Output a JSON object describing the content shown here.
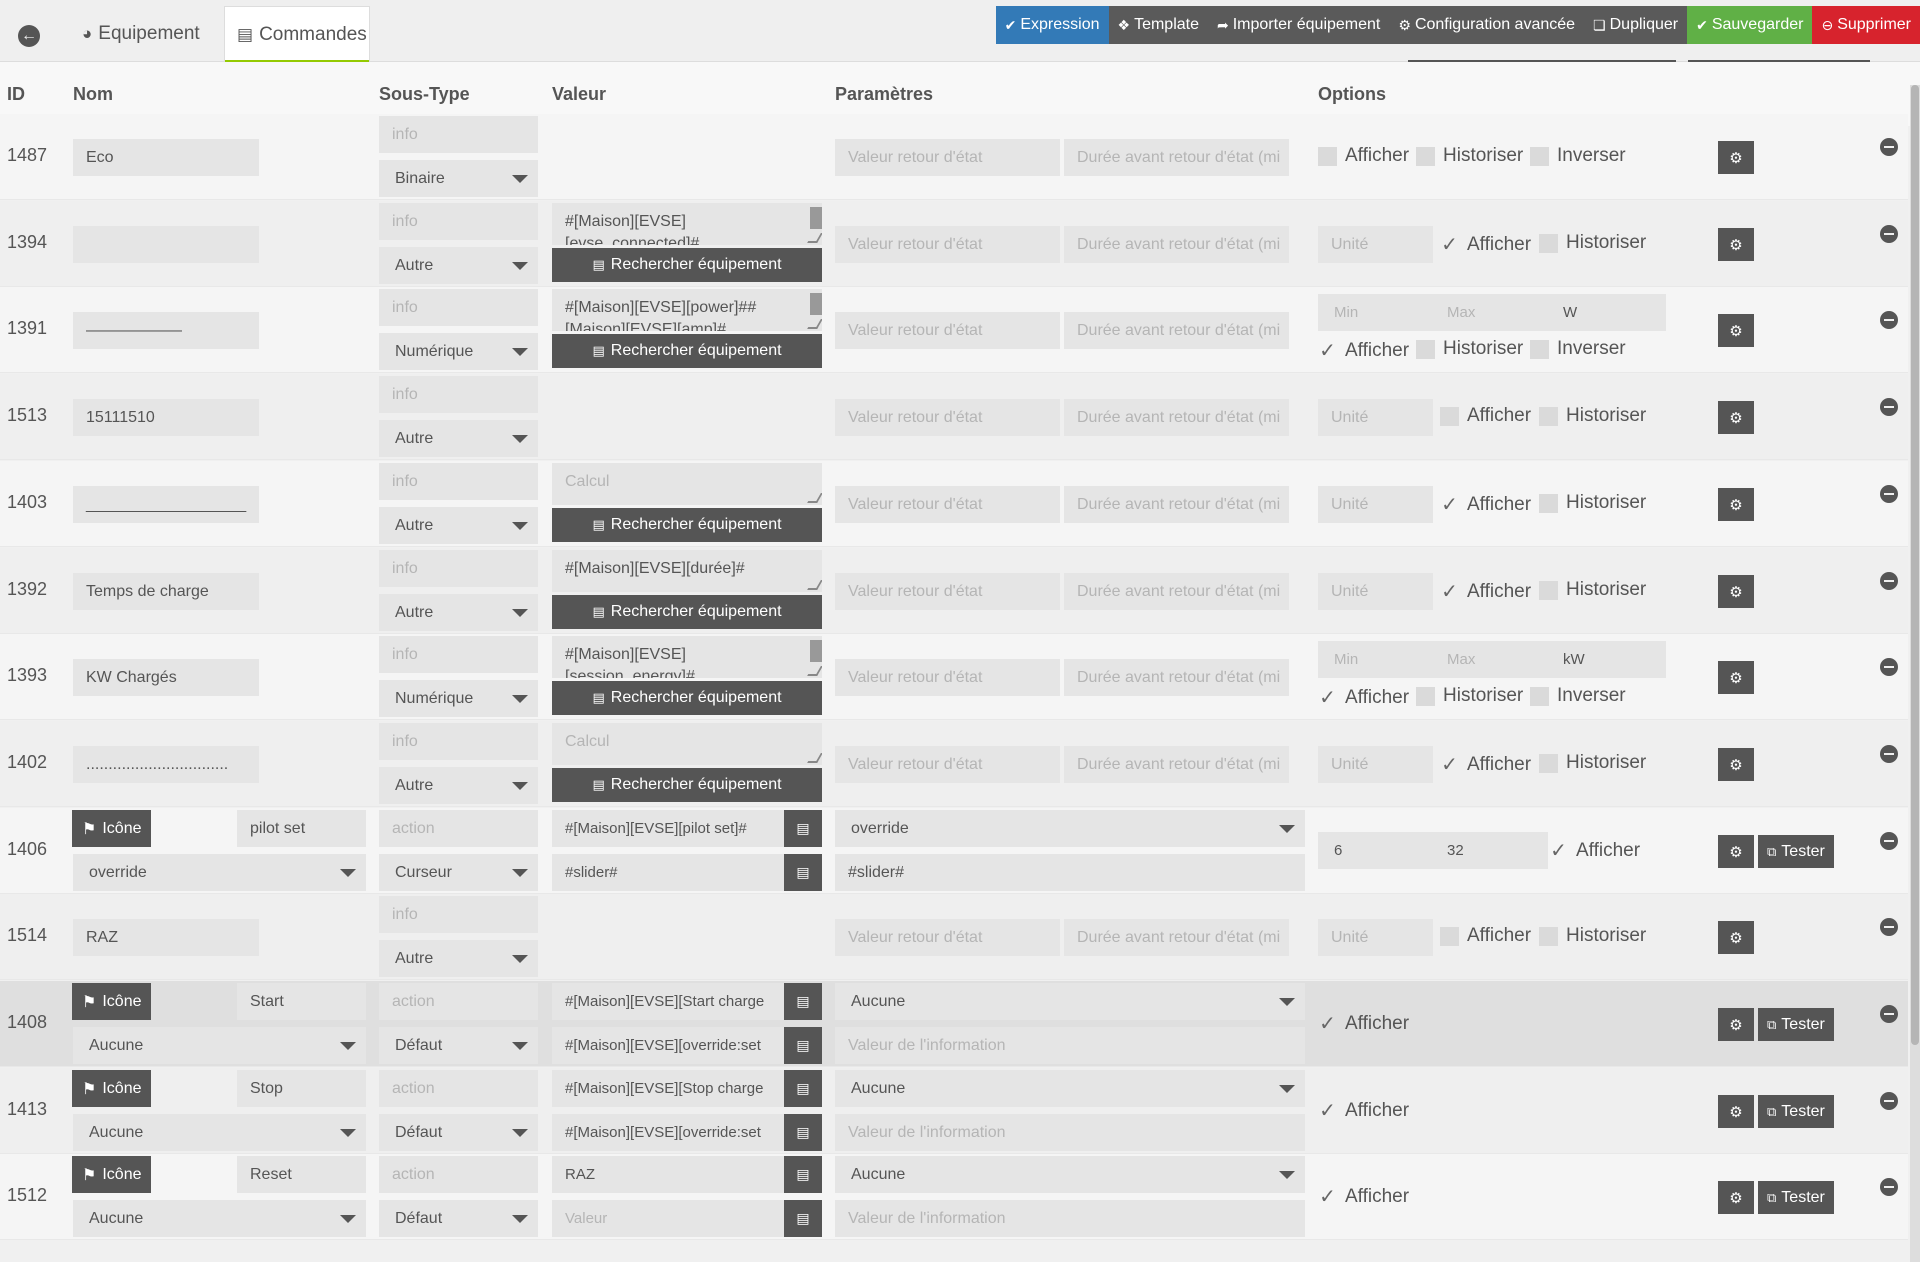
{
  "topbar": {
    "tabs": [
      {
        "icon": "tachometer-icon",
        "label": "Equipement"
      },
      {
        "icon": "list-icon",
        "label": "Commandes"
      }
    ],
    "actions": [
      {
        "label": "Expression",
        "icon": "check-icon"
      },
      {
        "label": "Template",
        "icon": "cubes-icon"
      },
      {
        "label": "Importer équipement",
        "icon": "share-icon"
      },
      {
        "label": "Configuration avancée",
        "icon": "cogs-icon"
      },
      {
        "label": "Dupliquer",
        "icon": "copy-icon"
      },
      {
        "label": "Sauvegarder",
        "icon": "check-circle-icon"
      },
      {
        "label": "Supprimer",
        "icon": "minus-circle-icon"
      }
    ],
    "colors": {
      "expression": "#337ab7",
      "save": "#60b046",
      "delete": "#d7232d",
      "active_tab": "#94ca02"
    }
  },
  "table": {
    "headers": {
      "id": "ID",
      "name": "Nom",
      "subtype": "Sous-Type",
      "value": "Valeur",
      "params": "Paramètres",
      "options": "Options"
    },
    "placeholders": {
      "type_info": "info",
      "type_action": "action",
      "return_value": "Valeur retour d'état",
      "return_duration": "Durée avant retour d'état (mi",
      "unit": "Unité",
      "min": "Min",
      "max": "Max",
      "info_value": "Valeur de l'information",
      "calc": "Calcul",
      "value": "Valeur"
    },
    "labels": {
      "search_equipment": "Rechercher équipement",
      "show": "Afficher",
      "historize": "Historiser",
      "invert": "Inverser",
      "icon": "Icône",
      "test": "Tester"
    }
  },
  "rows": [
    {
      "id": "1487",
      "name": "Eco",
      "subtype": "Binaire"
    },
    {
      "id": "1394",
      "name": "",
      "subtype": "Autre",
      "value": "#[Maison][EVSE]",
      "value2": "[evse_connected]#"
    },
    {
      "id": "1391",
      "name": "——————",
      "subtype": "Numérique",
      "value": "#[Maison][EVSE][power]##",
      "value2": "[Maison][EVSE][amp]#",
      "unit": "W"
    },
    {
      "id": "1513",
      "name": "15111510",
      "subtype": "Autre"
    },
    {
      "id": "1403",
      "name": "__________________",
      "subtype": "Autre"
    },
    {
      "id": "1392",
      "name": "Temps de charge",
      "subtype": "Autre",
      "value": "#[Maison][EVSE][durée]#"
    },
    {
      "id": "1393",
      "name": "KW Chargés",
      "subtype": "Numérique",
      "value": "#[Maison][EVSE]",
      "value2": "[session_energy]#",
      "unit": "kW"
    },
    {
      "id": "1402",
      "name": "................................",
      "subtype": "Autre"
    },
    {
      "id": "1406",
      "name": "pilot set",
      "icon_link": "override",
      "subtype": "Curseur",
      "value": "#[Maison][EVSE][pilot set]#",
      "value2": "#slider#",
      "param": "override",
      "param2": "#slider#",
      "min": "6",
      "max": "32"
    },
    {
      "id": "1514",
      "name": "RAZ",
      "subtype": "Autre"
    },
    {
      "id": "1408",
      "name": "Start",
      "icon_link": "Aucune",
      "subtype": "Défaut",
      "value": "#[Maison][EVSE][Start charge",
      "value2": "#[Maison][EVSE][override:set",
      "param": "Aucune"
    },
    {
      "id": "1413",
      "name": "Stop",
      "icon_link": "Aucune",
      "subtype": "Défaut",
      "value": "#[Maison][EVSE][Stop charge",
      "value2": "#[Maison][EVSE][override:set",
      "param": "Aucune"
    },
    {
      "id": "1512",
      "name": "Reset",
      "icon_link": "Aucune",
      "subtype": "Défaut",
      "value": "RAZ",
      "param": "Aucune"
    }
  ]
}
